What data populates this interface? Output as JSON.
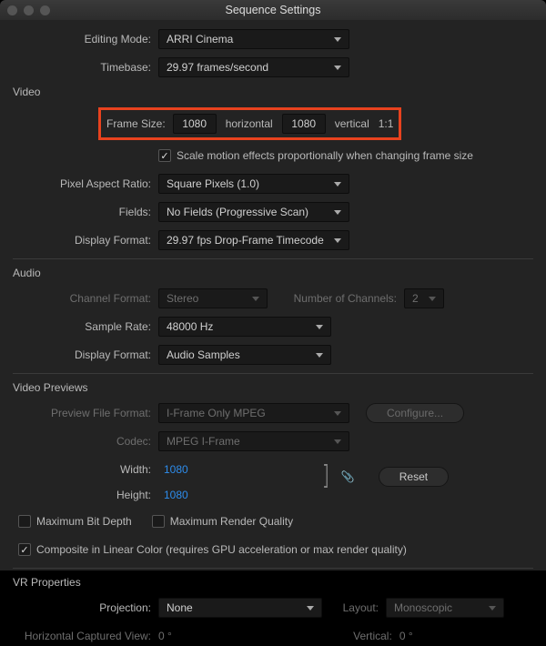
{
  "title": "Sequence Settings",
  "editing_mode": {
    "label": "Editing Mode:",
    "value": "ARRI Cinema"
  },
  "timebase": {
    "label": "Timebase:",
    "value": "29.97  frames/second"
  },
  "video": {
    "title": "Video",
    "frame_size": {
      "label": "Frame Size:",
      "w": "1080",
      "w_label": "horizontal",
      "h": "1080",
      "h_label": "vertical",
      "ratio": "1:1"
    },
    "scale_motion": {
      "label": "Scale motion effects proportionally when changing frame size",
      "checked": true
    },
    "pixel_aspect": {
      "label": "Pixel Aspect Ratio:",
      "value": "Square Pixels (1.0)"
    },
    "fields": {
      "label": "Fields:",
      "value": "No Fields (Progressive Scan)"
    },
    "display_format": {
      "label": "Display Format:",
      "value": "29.97 fps Drop-Frame Timecode"
    }
  },
  "audio": {
    "title": "Audio",
    "channel_format": {
      "label": "Channel Format:",
      "value": "Stereo"
    },
    "num_channels": {
      "label": "Number of Channels:",
      "value": "2"
    },
    "sample_rate": {
      "label": "Sample Rate:",
      "value": "48000 Hz"
    },
    "display_format": {
      "label": "Display Format:",
      "value": "Audio Samples"
    }
  },
  "previews": {
    "title": "Video Previews",
    "file_format": {
      "label": "Preview File Format:",
      "value": "I-Frame Only MPEG"
    },
    "configure": "Configure...",
    "codec": {
      "label": "Codec:",
      "value": "MPEG I-Frame"
    },
    "width": {
      "label": "Width:",
      "value": "1080"
    },
    "height": {
      "label": "Height:",
      "value": "1080"
    },
    "reset": "Reset",
    "max_bit_depth": "Maximum Bit Depth",
    "max_render_quality": "Maximum Render Quality",
    "composite": "Composite in Linear Color (requires GPU acceleration or max render quality)"
  },
  "vr": {
    "title": "VR Properties",
    "projection": {
      "label": "Projection:",
      "value": "None"
    },
    "layout": {
      "label": "Layout:",
      "value": "Monoscopic"
    },
    "h_view": {
      "label": "Horizontal Captured View:",
      "value": "0 °"
    },
    "vertical": {
      "label": "Vertical:",
      "value": "0 °"
    }
  }
}
